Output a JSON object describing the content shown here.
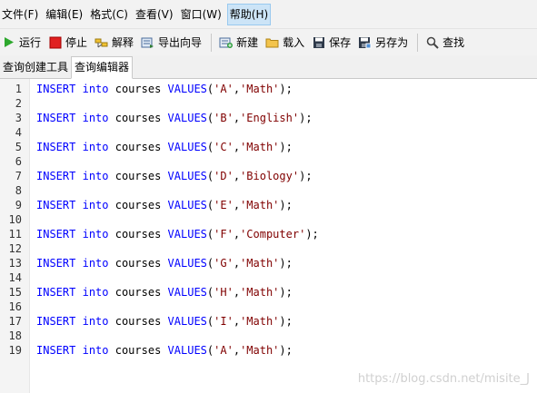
{
  "menu": [
    "文件(F)",
    "编辑(E)",
    "格式(C)",
    "查看(V)",
    "窗口(W)",
    "帮助(H)"
  ],
  "toolbar": {
    "run": "运行",
    "stop": "停止",
    "explain": "解释",
    "export_wizard": "导出向导",
    "new": "新建",
    "load": "载入",
    "save": "保存",
    "save_as": "另存为",
    "find": "查找"
  },
  "tabs": [
    "查询创建工具",
    "查询编辑器"
  ],
  "lines": [
    {
      "n": "1",
      "kw1": "INSERT",
      "kw2": "into",
      "table": "courses",
      "kw3": "VALUES",
      "a": "'A'",
      "b": "'Math'"
    },
    {
      "n": "2"
    },
    {
      "n": "3",
      "kw1": "INSERT",
      "kw2": "into",
      "table": "courses",
      "kw3": "VALUES",
      "a": "'B'",
      "b": "'English'"
    },
    {
      "n": "4"
    },
    {
      "n": "5",
      "kw1": "INSERT",
      "kw2": "into",
      "table": "courses",
      "kw3": "VALUES",
      "a": "'C'",
      "b": "'Math'"
    },
    {
      "n": "6"
    },
    {
      "n": "7",
      "kw1": "INSERT",
      "kw2": "into",
      "table": "courses",
      "kw3": "VALUES",
      "a": "'D'",
      "b": "'Biology'"
    },
    {
      "n": "8"
    },
    {
      "n": "9",
      "kw1": "INSERT",
      "kw2": "into",
      "table": "courses",
      "kw3": "VALUES",
      "a": "'E'",
      "b": "'Math'"
    },
    {
      "n": "10"
    },
    {
      "n": "11",
      "kw1": "INSERT",
      "kw2": "into",
      "table": "courses",
      "kw3": "VALUES",
      "a": "'F'",
      "b": "'Computer'"
    },
    {
      "n": "12"
    },
    {
      "n": "13",
      "kw1": "INSERT",
      "kw2": "into",
      "table": "courses",
      "kw3": "VALUES",
      "a": "'G'",
      "b": "'Math'"
    },
    {
      "n": "14"
    },
    {
      "n": "15",
      "kw1": "INSERT",
      "kw2": "into",
      "table": "courses",
      "kw3": "VALUES",
      "a": "'H'",
      "b": "'Math'"
    },
    {
      "n": "16"
    },
    {
      "n": "17",
      "kw1": "INSERT",
      "kw2": "into",
      "table": "courses",
      "kw3": "VALUES",
      "a": "'I'",
      "b": "'Math'"
    },
    {
      "n": "18"
    },
    {
      "n": "19",
      "kw1": "INSERT",
      "kw2": "into",
      "table": "courses",
      "kw3": "VALUES",
      "a": "'A'",
      "b": "'Math'"
    }
  ],
  "punct": {
    "open": "(",
    "comma": ",",
    "close": ");"
  },
  "watermark": "https://blog.csdn.net/misite_J",
  "colors": {
    "keyword": "#0000ff",
    "string": "#800000"
  }
}
